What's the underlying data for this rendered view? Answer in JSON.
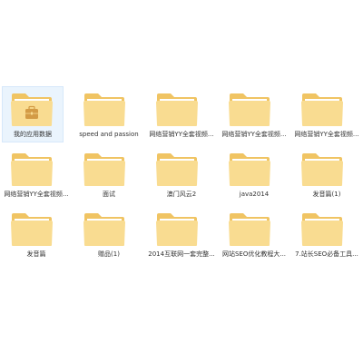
{
  "colors": {
    "folder_back": "#f0c463",
    "folder_front": "#f9dc91",
    "folder_paper": "#ffffff",
    "selection_bg": "#eaf4fd",
    "text": "#333333"
  },
  "folders": [
    {
      "label": "我的应用数据",
      "icon": "app-data-folder-icon",
      "selected": true
    },
    {
      "label": "speed and passion",
      "icon": "folder-icon",
      "selected": false
    },
    {
      "label": "网络营销YY全套视频...",
      "icon": "folder-icon",
      "selected": false
    },
    {
      "label": "网络营销YY全套视频...",
      "icon": "folder-icon",
      "selected": false
    },
    {
      "label": "网络营销YY全套视频...",
      "icon": "folder-icon",
      "selected": false
    },
    {
      "label": "网络营销YY全套视频...",
      "icon": "folder-icon",
      "selected": false
    },
    {
      "label": "面试",
      "icon": "folder-icon",
      "selected": false
    },
    {
      "label": "澳门风云2",
      "icon": "folder-icon",
      "selected": false
    },
    {
      "label": "java2014",
      "icon": "folder-icon",
      "selected": false
    },
    {
      "label": "发音篇(1)",
      "icon": "folder-icon",
      "selected": false
    },
    {
      "label": "发音篇",
      "icon": "folder-icon",
      "selected": false
    },
    {
      "label": "赠品(1)",
      "icon": "folder-icon",
      "selected": false
    },
    {
      "label": "2014互联网一套完整...",
      "icon": "folder-icon",
      "selected": false
    },
    {
      "label": "网站SEO优化教程大...",
      "icon": "folder-icon",
      "selected": false
    },
    {
      "label": "7.站长SEO必备工具...",
      "icon": "folder-icon",
      "selected": false
    }
  ]
}
